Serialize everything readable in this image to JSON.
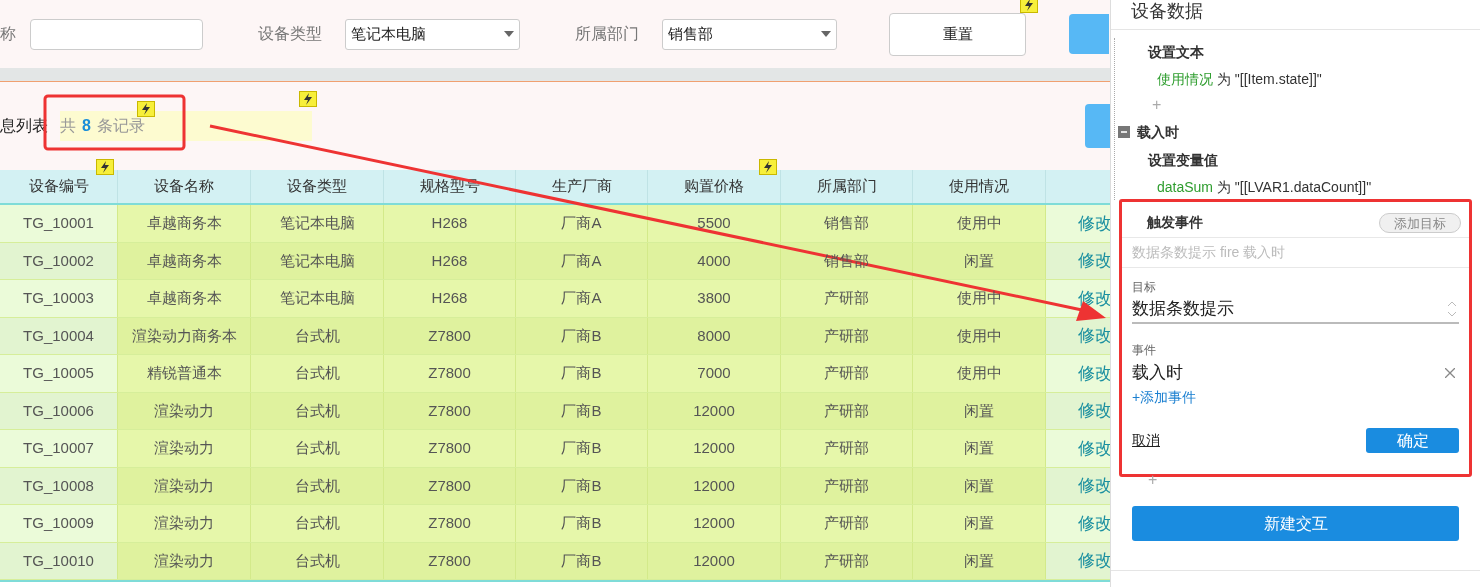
{
  "filter_bar": {
    "fields": [
      {
        "kind": "input",
        "label": "称"
      },
      {
        "kind": "select",
        "label": "设备类型",
        "value": "笔记本电脑"
      },
      {
        "kind": "select",
        "label": "所属部门",
        "value": "销售部"
      }
    ],
    "reset_button": "重置"
  },
  "list_header": {
    "title": "息列表",
    "count_prefix": "共",
    "count": "8",
    "count_suffix": "条记录"
  },
  "table": {
    "columns": [
      "设备编号",
      "设备名称",
      "设备类型",
      "规格型号",
      "生产厂商",
      "购置价格",
      "所属部门",
      "使用情况"
    ],
    "rows": [
      {
        "cells": [
          "TG_10001",
          "卓越商务本",
          "笔记本电脑",
          "H268",
          "厂商A",
          "5500",
          "销售部",
          "使用中"
        ],
        "action": "修改"
      },
      {
        "cells": [
          "TG_10002",
          "卓越商务本",
          "笔记本电脑",
          "H268",
          "厂商A",
          "4000",
          "销售部",
          "闲置"
        ],
        "action": "修改"
      },
      {
        "cells": [
          "TG_10003",
          "卓越商务本",
          "笔记本电脑",
          "H268",
          "厂商A",
          "3800",
          "产研部",
          "使用中"
        ],
        "action": "修改"
      },
      {
        "cells": [
          "TG_10004",
          "渲染动力商务本",
          "台式机",
          "Z7800",
          "厂商B",
          "8000",
          "产研部",
          "使用中"
        ],
        "action": "修改"
      },
      {
        "cells": [
          "TG_10005",
          "精锐普通本",
          "台式机",
          "Z7800",
          "厂商B",
          "7000",
          "产研部",
          "使用中"
        ],
        "action": "修改"
      },
      {
        "cells": [
          "TG_10006",
          "渲染动力",
          "台式机",
          "Z7800",
          "厂商B",
          "12000",
          "产研部",
          "闲置"
        ],
        "action": "修改"
      },
      {
        "cells": [
          "TG_10007",
          "渲染动力",
          "台式机",
          "Z7800",
          "厂商B",
          "12000",
          "产研部",
          "闲置"
        ],
        "action": "修改"
      },
      {
        "cells": [
          "TG_10008",
          "渲染动力",
          "台式机",
          "Z7800",
          "厂商B",
          "12000",
          "产研部",
          "闲置"
        ],
        "action": "修改"
      },
      {
        "cells": [
          "TG_10009",
          "渲染动力",
          "台式机",
          "Z7800",
          "厂商B",
          "12000",
          "产研部",
          "闲置"
        ],
        "action": "修改"
      },
      {
        "cells": [
          "TG_10010",
          "渲染动力",
          "台式机",
          "Z7800",
          "厂商B",
          "12000",
          "产研部",
          "闲置"
        ],
        "action": "修改"
      }
    ]
  },
  "interactions_panel": {
    "title": "设备数据",
    "items": [
      {
        "kind": "action",
        "text": "设置文本"
      },
      {
        "kind": "assignment",
        "target": "使用情况",
        "op": "为",
        "value": "\"[[Item.state]]\""
      },
      {
        "kind": "add",
        "text": "+"
      },
      {
        "kind": "event",
        "text": "载入时",
        "expanded": true
      },
      {
        "kind": "action",
        "text": "设置变量值"
      },
      {
        "kind": "assignment",
        "target": "dataSum",
        "op": "为",
        "value": "\"[[LVAR1.dataCount]]\""
      }
    ],
    "editor": {
      "title": "触发事件",
      "add_target_button": "添加目标",
      "summary": "数据条数提示 fire 载入时",
      "target_label": "目标",
      "target_value": "数据条数提示",
      "event_label": "事件",
      "event_value": "载入时",
      "add_event_link": "+添加事件",
      "cancel": "取消",
      "confirm": "确定"
    },
    "add_after": "+",
    "new_interaction_button": "新建交互"
  }
}
